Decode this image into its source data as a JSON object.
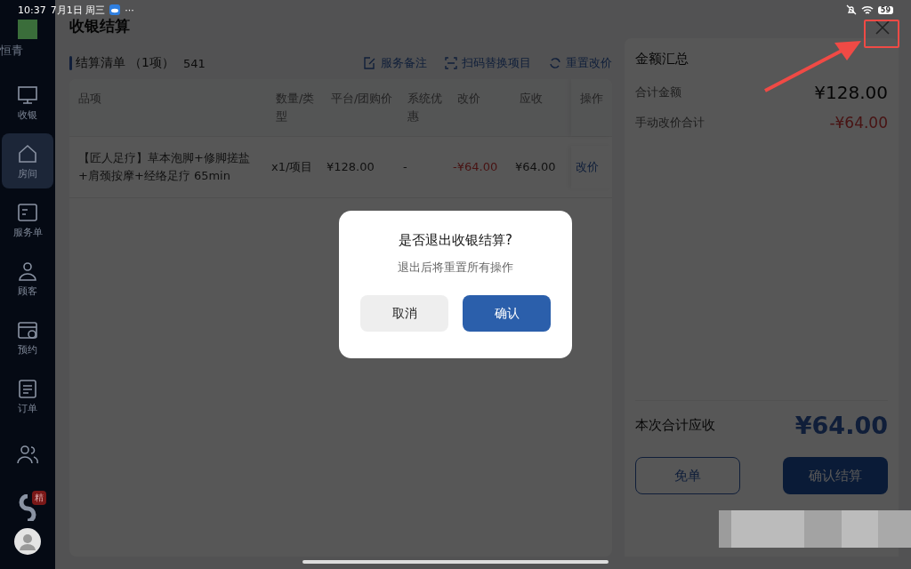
{
  "status_bar": {
    "time": "10:37",
    "date": "7月1日 周三",
    "more": "···",
    "battery": "59"
  },
  "sidebar": {
    "brand": "恒青",
    "items": [
      {
        "label": "收银",
        "selected": false
      },
      {
        "label": "房间",
        "selected": true
      },
      {
        "label": "服务单",
        "selected": false
      },
      {
        "label": "顾客",
        "selected": false
      },
      {
        "label": "预约",
        "selected": false
      },
      {
        "label": "订单",
        "selected": false
      },
      {
        "selected": false
      }
    ],
    "badge": "精"
  },
  "page": {
    "title": "收银结算",
    "section_title": "结算清单",
    "count": "（1项）",
    "code": "541",
    "actions": [
      {
        "label": "服务备注"
      },
      {
        "label": "扫码替换项目"
      },
      {
        "label": "重置改价"
      }
    ]
  },
  "table": {
    "columns": [
      "品项",
      "数量/类型",
      "平台/团购价",
      "系统优惠",
      "改价",
      "应收",
      "操作"
    ],
    "rows": [
      {
        "item": "【匠人足疗】草本泡脚+修脚搓盐+肩颈按摩+经络足疗 65min",
        "qty": "x1/项目",
        "price": "¥128.00",
        "discount": "-",
        "adjust": "-¥64.00",
        "due": "¥64.00",
        "action": "改价"
      }
    ]
  },
  "summary": {
    "title": "金额汇总",
    "lines": [
      {
        "label": "合计金额",
        "value": "¥128.00",
        "kind": "normal"
      },
      {
        "label": "手动改价合计",
        "value": "-¥64.00",
        "kind": "negative"
      }
    ],
    "total_label": "本次合计应收",
    "total": "¥64.00",
    "buttons": [
      {
        "label": "免单",
        "kind": "outline"
      },
      {
        "label": "确认结算",
        "kind": "primary"
      }
    ]
  },
  "dialog": {
    "title": "是否退出收银结算?",
    "message": "退出后将重置所有操作",
    "buttons": [
      {
        "label": "取消",
        "kind": "secondary"
      },
      {
        "label": "确认",
        "kind": "primary"
      }
    ]
  }
}
